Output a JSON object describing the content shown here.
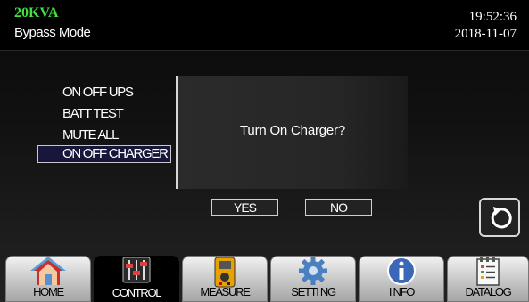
{
  "header": {
    "model": "20KVA",
    "mode": "Bypass Mode",
    "time": "19:52:36",
    "date": "2018-11-07"
  },
  "control_menu": {
    "items": [
      "ON OFF UPS",
      "BATT TEST",
      "MUTE ALL",
      "ON OFF CHARGER"
    ],
    "selected": "ON OFF CHARGER"
  },
  "dialog": {
    "message": "Turn On Charger?",
    "yes_label": "YES",
    "no_label": "NO"
  },
  "nav_tabs": [
    {
      "label": "HOME",
      "icon": "home-icon"
    },
    {
      "label": "CONTROL",
      "icon": "sliders-icon"
    },
    {
      "label": "MEASURE",
      "icon": "multimeter-icon"
    },
    {
      "label": "SETTI NG",
      "icon": "gear-icon"
    },
    {
      "label": "I NFO",
      "icon": "info-icon"
    },
    {
      "label": "DATALOG",
      "icon": "datalog-icon"
    }
  ],
  "active_tab": "CONTROL",
  "back_icon": "back-arrow-icon",
  "colors": {
    "model_text": "#3fe03f",
    "selected_bg": "#16173a",
    "header_bg": "#000000"
  }
}
